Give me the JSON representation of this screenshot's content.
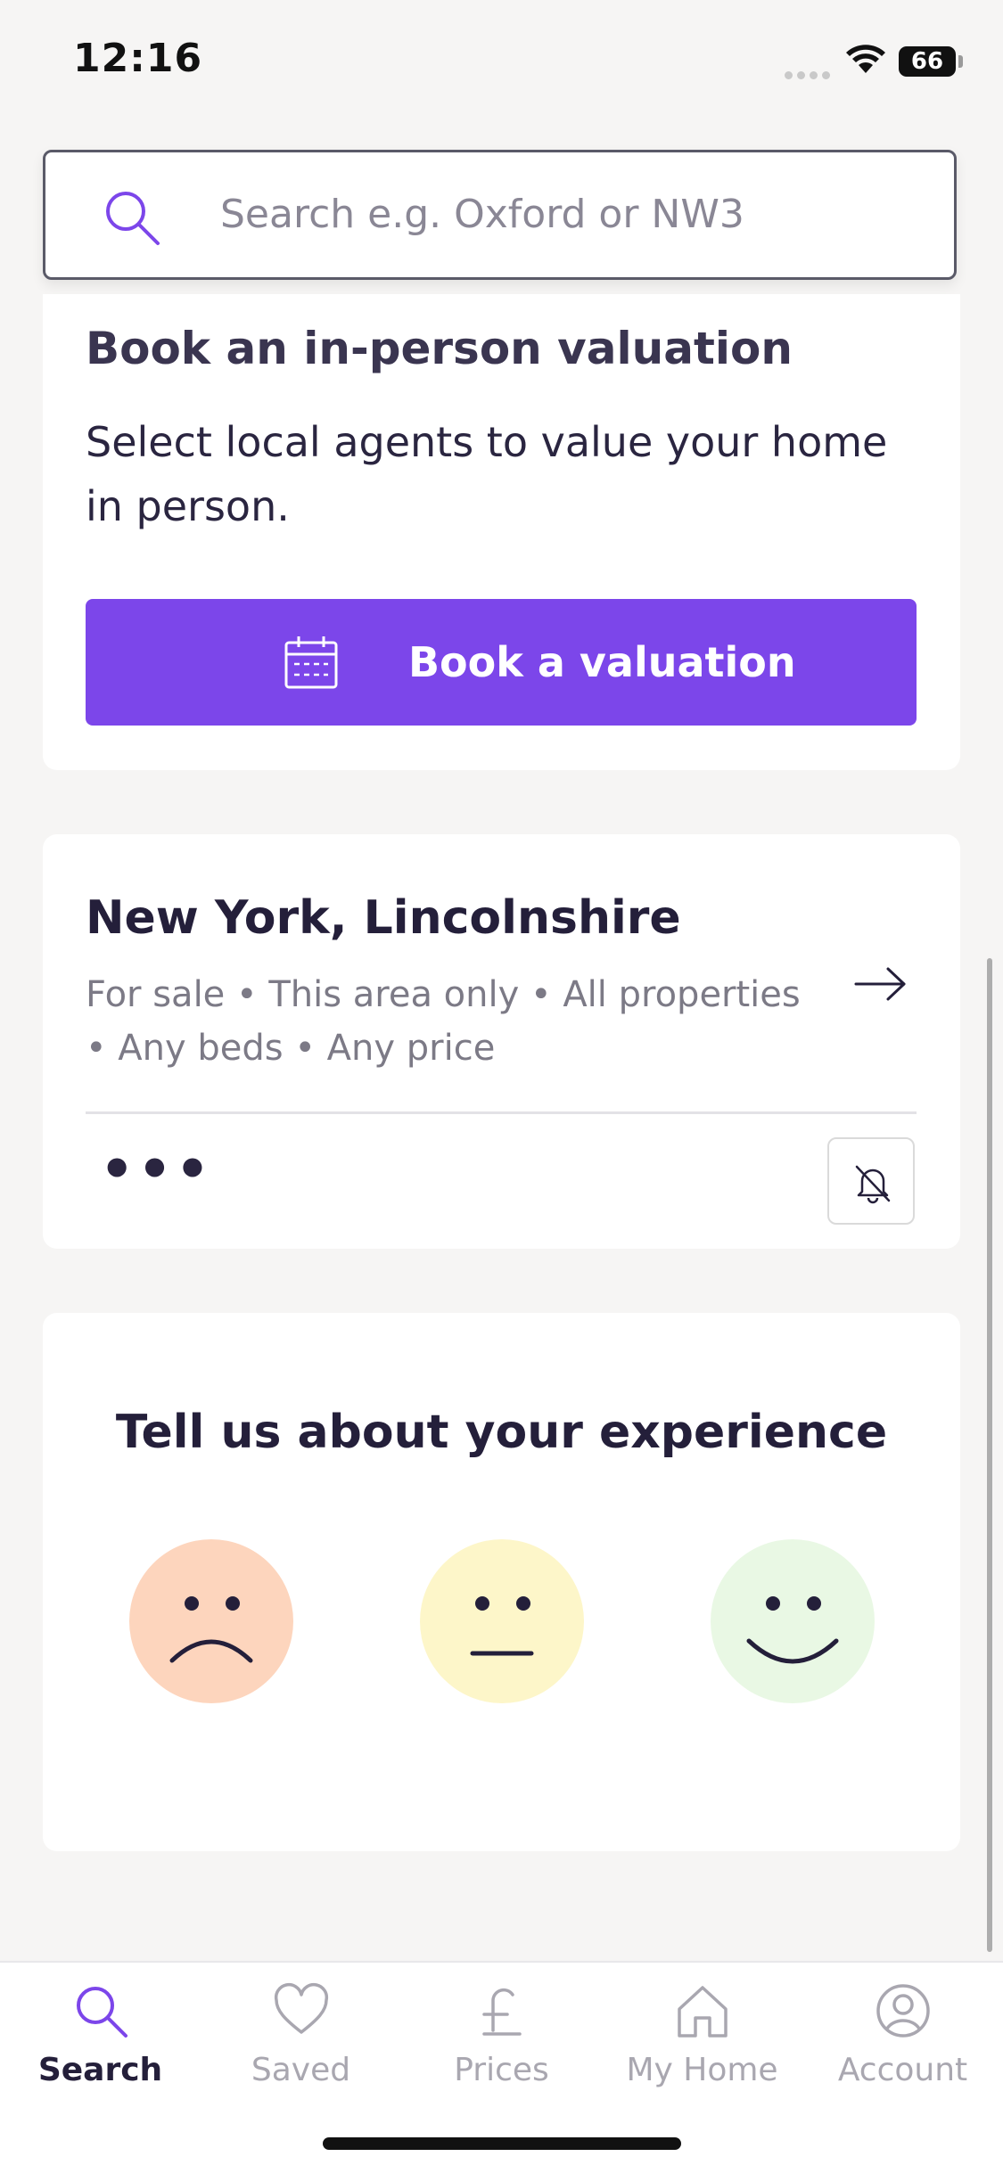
{
  "status_bar": {
    "time": "12:16",
    "battery": "66"
  },
  "search": {
    "placeholder": "Search e.g. Oxford or NW3"
  },
  "valuation_card": {
    "title": "Book an in-person valuation",
    "description": "Select local agents to value your home in person.",
    "button_label": "Book a valuation"
  },
  "saved_search_card": {
    "location": "New York, Lincolnshire",
    "criteria": "For sale • This area only • All properties • Any beds • Any price",
    "more_label": "•••"
  },
  "feedback_card": {
    "heading": "Tell us about your experience",
    "faces": [
      "sad-face-icon",
      "neutral-face-icon",
      "happy-face-icon"
    ]
  },
  "tab_bar": {
    "tabs": [
      {
        "label": "Search",
        "icon": "search-icon",
        "active": true
      },
      {
        "label": "Saved",
        "icon": "heart-icon",
        "active": false
      },
      {
        "label": "Prices",
        "icon": "pound-icon",
        "active": false
      },
      {
        "label": "My Home",
        "icon": "home-icon",
        "active": false
      },
      {
        "label": "Account",
        "icon": "account-icon",
        "active": false
      }
    ]
  },
  "colors": {
    "accent": "#7c46ea",
    "text": "#241f3a",
    "muted": "#7c7a86"
  }
}
